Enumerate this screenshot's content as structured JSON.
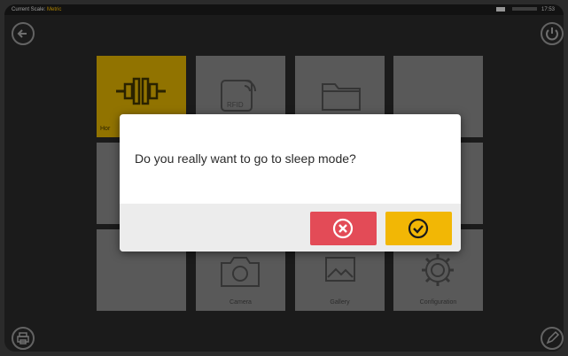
{
  "status_bar": {
    "left_text": "Current Scale:",
    "left_value": "Metric",
    "right_text": "17:53"
  },
  "nav": {
    "back_icon": "back-arrow-icon",
    "power_icon": "power-icon",
    "bottom_left_icon": "print-icon",
    "bottom_right_icon": "edit-icon"
  },
  "tiles": [
    {
      "label": "Hor",
      "icon": "coupling-icon",
      "active": true
    },
    {
      "label": "",
      "icon": "rfid-icon",
      "sublabel": "RFID"
    },
    {
      "label": "",
      "icon": "folder-icon"
    },
    {
      "label": "",
      "icon": ""
    },
    {
      "label": "Camera",
      "icon": "camera-icon"
    },
    {
      "label": "Gallery",
      "icon": "image-icon"
    },
    {
      "label": "Configuration",
      "icon": "gear-icon"
    }
  ],
  "dialog": {
    "message": "Do you really want to go to sleep mode?",
    "cancel_icon": "close-icon",
    "confirm_icon": "check-icon"
  },
  "colors": {
    "accent_yellow": "#f2b705",
    "cancel_red": "#e34b57",
    "tile_gray": "#7c7c7c",
    "tile_active": "#c9a000"
  }
}
